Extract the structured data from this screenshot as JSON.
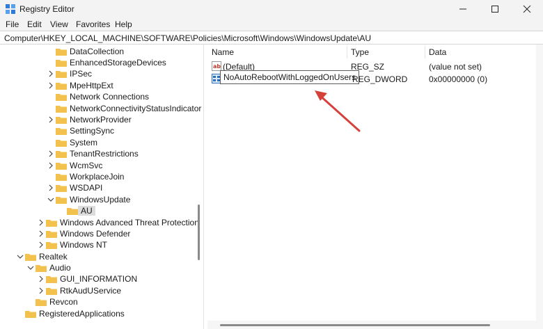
{
  "window": {
    "title": "Registry Editor"
  },
  "menu": [
    "File",
    "Edit",
    "View",
    "Favorites",
    "Help"
  ],
  "address": "Computer\\HKEY_LOCAL_MACHINE\\SOFTWARE\\Policies\\Microsoft\\Windows\\WindowsUpdate\\AU",
  "tree": [
    {
      "label": "DataCollection",
      "chevron": "none"
    },
    {
      "label": "EnhancedStorageDevices",
      "chevron": "none"
    },
    {
      "label": "IPSec",
      "chevron": "right"
    },
    {
      "label": "MpeHttpExt",
      "chevron": "right"
    },
    {
      "label": "Network Connections",
      "chevron": "none"
    },
    {
      "label": "NetworkConnectivityStatusIndicator",
      "chevron": "none"
    },
    {
      "label": "NetworkProvider",
      "chevron": "right"
    },
    {
      "label": "SettingSync",
      "chevron": "none"
    },
    {
      "label": "System",
      "chevron": "none"
    },
    {
      "label": "TenantRestrictions",
      "chevron": "right"
    },
    {
      "label": "WcmSvc",
      "chevron": "right"
    },
    {
      "label": "WorkplaceJoin",
      "chevron": "none"
    },
    {
      "label": "WSDAPI",
      "chevron": "right"
    },
    {
      "label": "WindowsUpdate",
      "chevron": "down"
    },
    {
      "label": "AU",
      "chevron": "none"
    },
    {
      "label": "Windows Advanced Threat Protection",
      "chevron": "right"
    },
    {
      "label": "Windows Defender",
      "chevron": "right"
    },
    {
      "label": "Windows NT",
      "chevron": "right"
    },
    {
      "label": "Realtek",
      "chevron": "down"
    },
    {
      "label": "Audio",
      "chevron": "down"
    },
    {
      "label": "GUI_INFORMATION",
      "chevron": "right"
    },
    {
      "label": "RtkAudUService",
      "chevron": "right"
    },
    {
      "label": "Revcon",
      "chevron": "none"
    },
    {
      "label": "RegisteredApplications",
      "chevron": "none"
    }
  ],
  "columns": {
    "name": "Name",
    "type": "Type",
    "data": "Data"
  },
  "values": [
    {
      "name": "(Default)",
      "type": "REG_SZ",
      "data": "(value not set)",
      "icon": "string-value-icon"
    },
    {
      "name": "NoAutoRebootWithLoggedOnUsers",
      "type": "REG_DWORD",
      "data": "0x00000000 (0)",
      "icon": "dword-value-icon"
    }
  ],
  "colors": {
    "folder": "#f2c14e",
    "arrow": "#d6403a",
    "selection": "#dcdcdc"
  }
}
